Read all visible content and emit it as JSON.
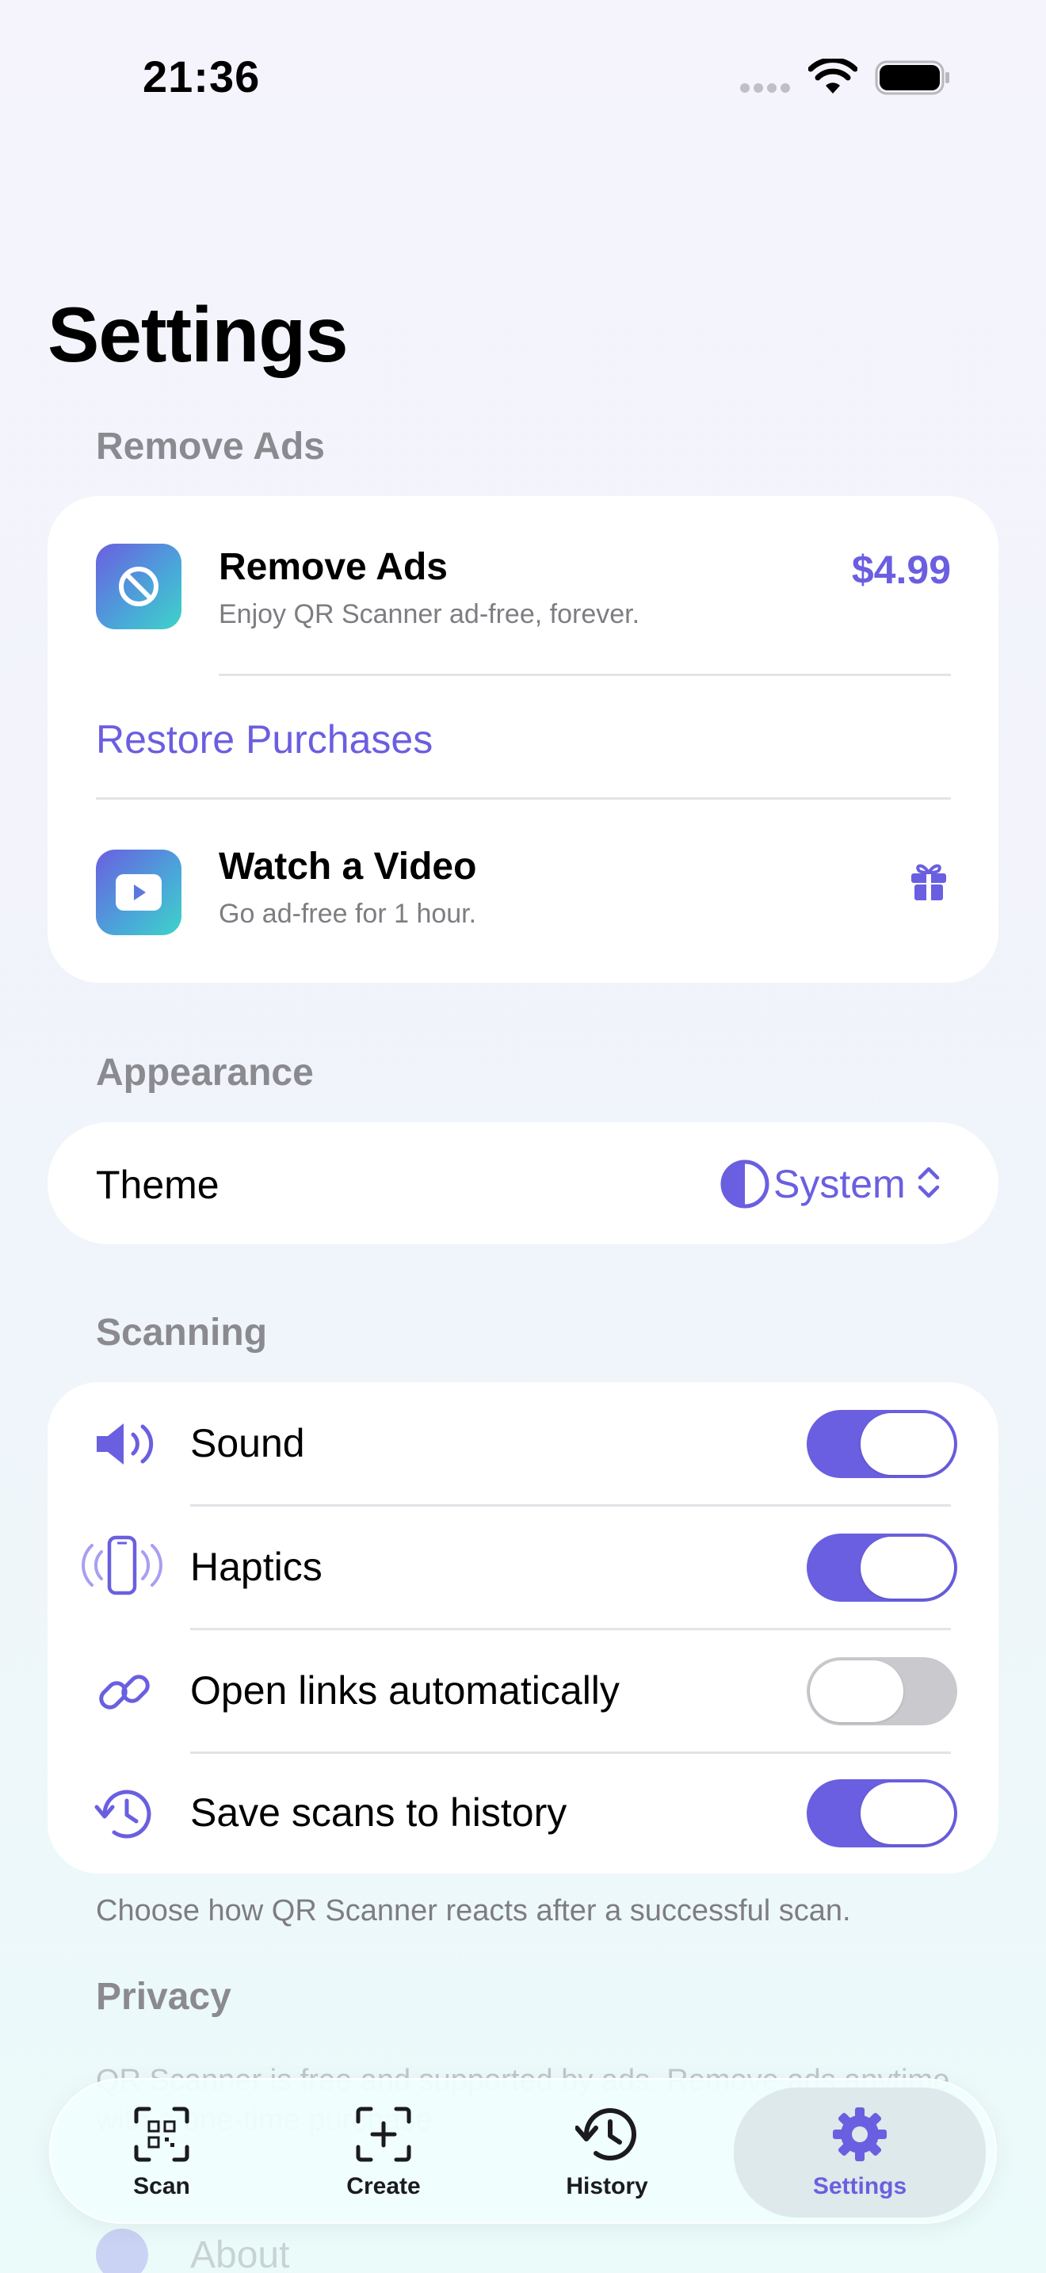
{
  "status_bar": {
    "time": "21:36"
  },
  "page_title": "Settings",
  "sections": {
    "remove_ads": {
      "header": "Remove Ads",
      "remove_ads_row": {
        "title": "Remove Ads",
        "subtitle": "Enjoy QR Scanner ad-free, forever.",
        "price": "$4.99"
      },
      "restore_label": "Restore Purchases",
      "watch_video_row": {
        "title": "Watch a Video",
        "subtitle": "Go ad-free for 1 hour."
      }
    },
    "appearance": {
      "header": "Appearance",
      "theme_label": "Theme",
      "theme_value": "System"
    },
    "scanning": {
      "header": "Scanning",
      "items": [
        {
          "label": "Sound",
          "icon": "speaker-icon",
          "enabled": true
        },
        {
          "label": "Haptics",
          "icon": "phone-vibrate-icon",
          "enabled": true
        },
        {
          "label": "Open links automatically",
          "icon": "link-icon",
          "enabled": false
        },
        {
          "label": "Save scans to history",
          "icon": "history-icon",
          "enabled": true
        }
      ],
      "footnote": "Choose how QR Scanner reacts after a successful scan."
    },
    "privacy": {
      "header": "Privacy",
      "text": "QR Scanner is free and supported by ads. Remove ads anytime with a one-time purchase."
    },
    "about": {
      "label": "About"
    }
  },
  "tab_bar": {
    "tabs": [
      {
        "label": "Scan",
        "icon": "qr-code-scan-icon"
      },
      {
        "label": "Create",
        "icon": "plus-square-icon"
      },
      {
        "label": "History",
        "icon": "clock-history-icon"
      },
      {
        "label": "Settings",
        "icon": "gear-icon",
        "active": true
      }
    ]
  },
  "colors": {
    "accent": "#6a5fe0",
    "secondary_text": "#7d7d82"
  }
}
